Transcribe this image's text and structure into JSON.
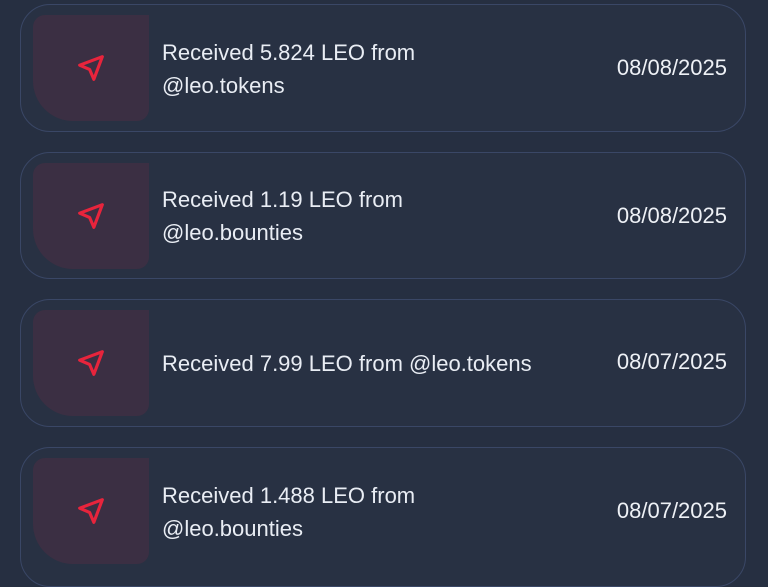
{
  "transactions": [
    {
      "text": "Received 5.824 LEO from @leo.tokens",
      "date": "08/08/2025",
      "icon": "send-icon"
    },
    {
      "text": "Received 1.19 LEO from @leo.bounties",
      "date": "08/08/2025",
      "icon": "send-icon"
    },
    {
      "text": "Received 7.99 LEO from @leo.tokens",
      "date": "08/07/2025",
      "icon": "send-icon"
    },
    {
      "text": "Received 1.488 LEO from @leo.bounties",
      "date": "08/07/2025",
      "icon": "send-icon"
    }
  ],
  "colors": {
    "background": "#262f41",
    "card_border": "#3a4766",
    "icon_tile": "#3b2f43",
    "icon_accent": "#e8243c",
    "text": "#e9edf4"
  }
}
